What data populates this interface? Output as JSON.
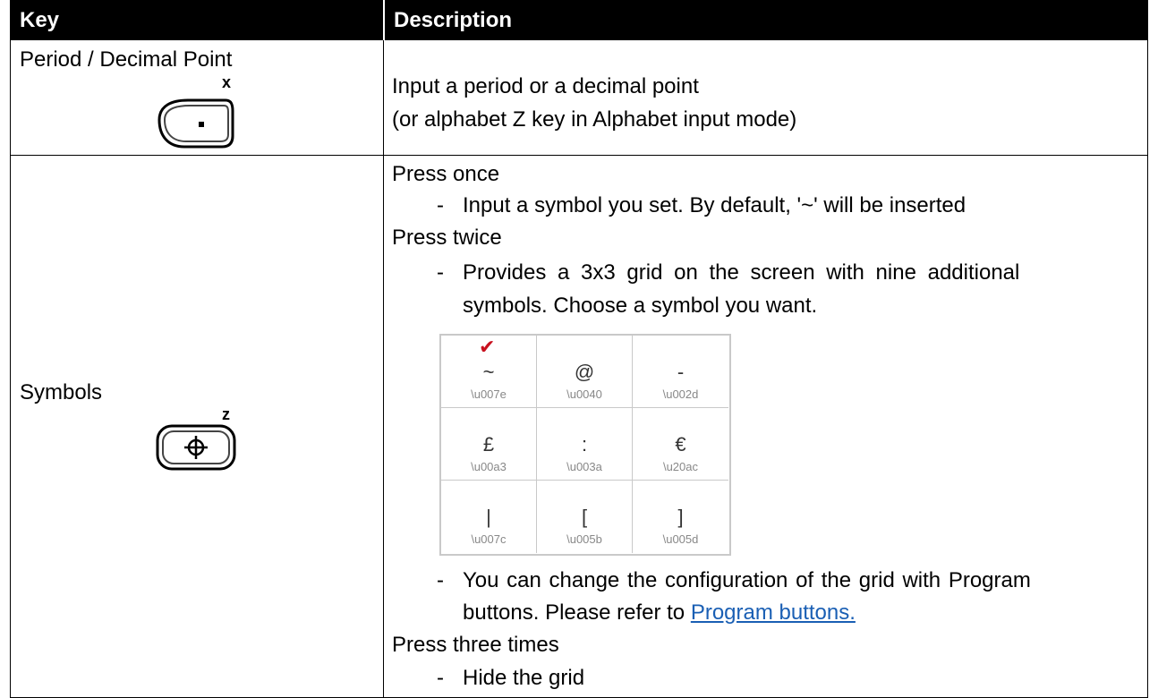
{
  "header": {
    "key": "Key",
    "description": "Description"
  },
  "rows": [
    {
      "key_name": "Period / Decimal Point",
      "key_superscript": "x",
      "key_icon": "period-key-icon",
      "description": [
        "Input a period or a decimal point",
        "(or alphabet Z key in Alphabet input mode)"
      ]
    },
    {
      "key_name": "Symbols",
      "key_superscript": "z",
      "key_icon": "crosshair-key-icon",
      "press_once": "Press once",
      "press_once_item": "Input a symbol you set. By default, '~' will be inserted",
      "press_twice": "Press twice",
      "press_twice_item_l1": "Provides a 3x3 grid on the screen with nine additional",
      "press_twice_item_l2": "symbols. Choose a symbol you want.",
      "change_item_l1": "You can change the configuration of the grid with Program",
      "change_item_l2_prefix": "buttons. Please refer to ",
      "change_item_link": "Program buttons.",
      "press_three": "Press three times",
      "press_three_item": "Hide the grid",
      "bullet": "-"
    }
  ],
  "symbol_grid": [
    {
      "symbol": "~",
      "code": "\\u007e",
      "selected": true
    },
    {
      "symbol": "@",
      "code": "\\u0040"
    },
    {
      "symbol": "-",
      "code": "\\u002d"
    },
    {
      "symbol": "£",
      "code": "\\u00a3"
    },
    {
      "symbol": ":",
      "code": "\\u003a"
    },
    {
      "symbol": "€",
      "code": "\\u20ac"
    },
    {
      "symbol": "|",
      "code": "\\u007c"
    },
    {
      "symbol": "[",
      "code": "\\u005b"
    },
    {
      "symbol": "]",
      "code": "\\u005d"
    }
  ],
  "checkmark": "✔",
  "colors": {
    "header_bg": "#000000",
    "link": "#1a5fb4",
    "checkmark": "#c8101e",
    "grid_border": "#c9c9c9"
  }
}
